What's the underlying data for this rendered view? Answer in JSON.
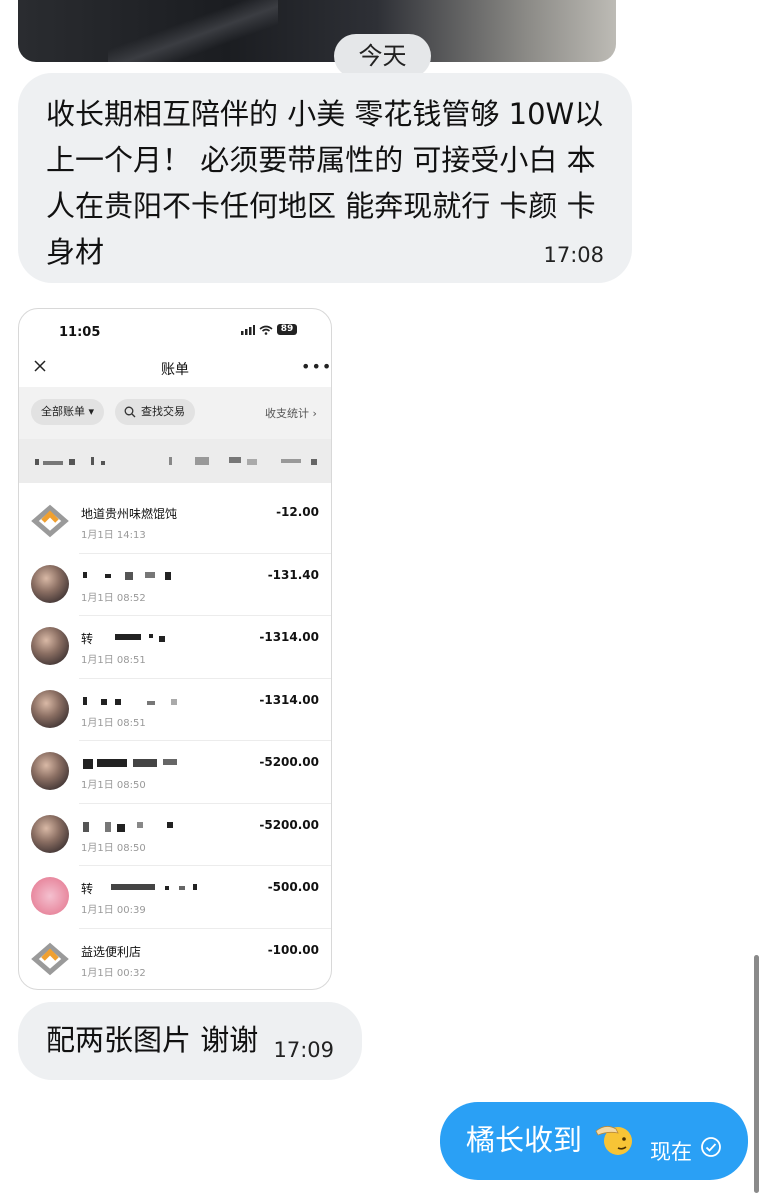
{
  "chat": {
    "date_divider": "今天",
    "messages": [
      {
        "text": "收长期相互陪伴的 小美 零花钱管够 10W以上一个月！ 必须要带属性的 可接受小白 本人在贵阳不卡任何地区 能奔现就行 卡颜 卡身材",
        "time": "17:08"
      },
      {
        "text": "配两张图片 谢谢",
        "time": "17:09"
      }
    ],
    "outgoing": {
      "text": "橘长收到",
      "time": "现在",
      "emoji_icon": "saluting-face-icon",
      "status_icon": "check-circle-icon"
    }
  },
  "bill_screenshot": {
    "status_time": "11:05",
    "battery": "89",
    "title": "账单",
    "filter_all": "全部账单",
    "search_label": "查找交易",
    "stats_label": "收支统计",
    "transactions": [
      {
        "name": "地道贵州味燃馄饨",
        "date": "1月1日 14:13",
        "amount": "-12.00",
        "avatar": "logo"
      },
      {
        "name": "",
        "date": "1月1日 08:52",
        "amount": "-131.40",
        "avatar": "photo"
      },
      {
        "name": "转",
        "date": "1月1日 08:51",
        "amount": "-1314.00",
        "avatar": "photo"
      },
      {
        "name": "",
        "date": "1月1日 08:51",
        "amount": "-1314.00",
        "avatar": "photo"
      },
      {
        "name": "",
        "date": "1月1日 08:50",
        "amount": "-5200.00",
        "avatar": "photo"
      },
      {
        "name": "",
        "date": "1月1日 08:50",
        "amount": "-5200.00",
        "avatar": "photo"
      },
      {
        "name": "转",
        "date": "1月1日 00:39",
        "amount": "-500.00",
        "avatar": "pink"
      },
      {
        "name": "益选便利店",
        "date": "1月1日 00:32",
        "amount": "-100.00",
        "avatar": "logo"
      }
    ]
  },
  "colors": {
    "outgoing_bubble": "#2aa0f5",
    "incoming_bubble": "#eef0f2"
  }
}
